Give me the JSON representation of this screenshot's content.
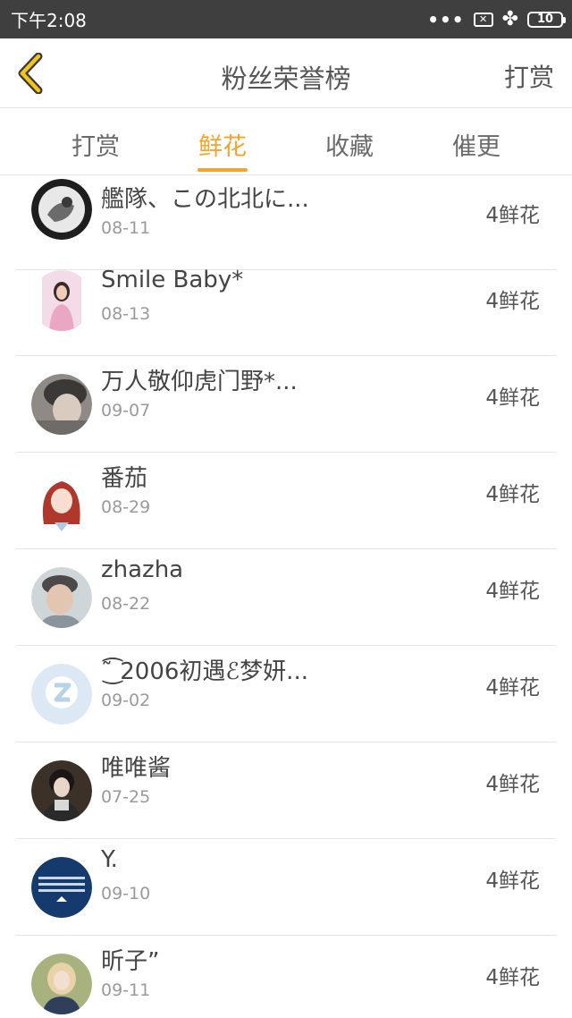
{
  "status": {
    "time": "下午2:08",
    "dots": "•••",
    "battery": "10"
  },
  "header": {
    "title": "粉丝荣誉榜",
    "right_action": "打赏"
  },
  "tabs": [
    {
      "label": "打赏",
      "active": false
    },
    {
      "label": "鲜花",
      "active": true
    },
    {
      "label": "收藏",
      "active": false
    },
    {
      "label": "催更",
      "active": false
    }
  ],
  "accent_color": "#f4a42a",
  "list": [
    {
      "name": "艦隊、この北北に...",
      "date": "08-11",
      "amount": "4鲜花"
    },
    {
      "name": "Smile Baby*",
      "date": "08-13",
      "amount": "4鲜花"
    },
    {
      "name": "万人敬仰虎门野*...",
      "date": "09-07",
      "amount": "4鲜花"
    },
    {
      "name": "番茄",
      "date": "08-29",
      "amount": "4鲜花"
    },
    {
      "name": "zhazha",
      "date": "08-22",
      "amount": "4鲜花"
    },
    {
      "name": "˜͜͡ 2006初遇ℰ梦妍...",
      "date": "09-02",
      "amount": "4鲜花"
    },
    {
      "name": "唯唯酱",
      "date": "07-25",
      "amount": "4鲜花"
    },
    {
      "name": "Y.",
      "date": "09-10",
      "amount": "4鲜花"
    },
    {
      "name": "昕子”",
      "date": "09-11",
      "amount": "4鲜花"
    }
  ]
}
